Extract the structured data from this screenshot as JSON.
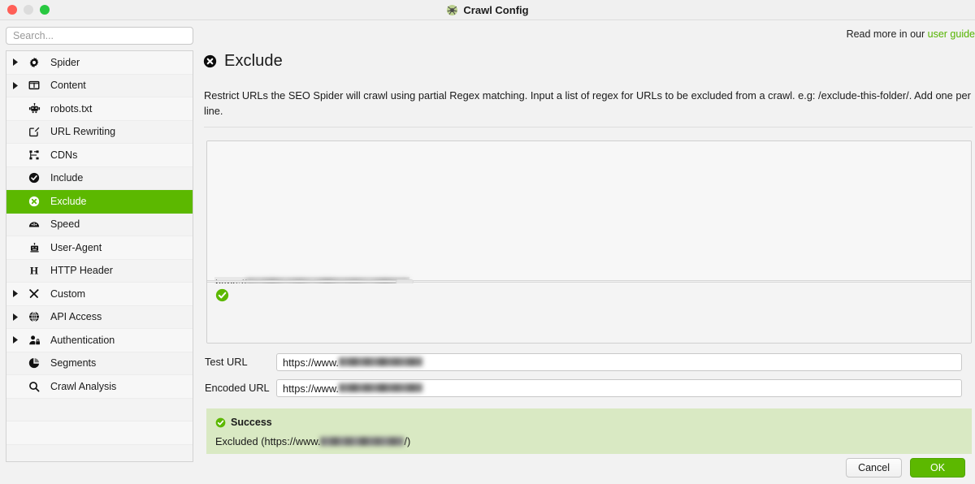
{
  "window": {
    "title": "Crawl Config",
    "title_icon": "spider-icon",
    "controls": {
      "close": "close-button",
      "minimize": "minimize-button",
      "maximize": "maximize-button"
    }
  },
  "colors": {
    "accent_green": "#5cb800",
    "link_green": "#55b400",
    "success_bg": "#d9e9c3",
    "traffic_red": "#ff5f57",
    "traffic_gray": "#dcdcdc",
    "traffic_green": "#28c840"
  },
  "sidebar": {
    "search": {
      "placeholder": "Search...",
      "value": ""
    },
    "items": [
      {
        "label": "Spider",
        "icon": "gear-icon",
        "expandable": true,
        "selected": false
      },
      {
        "label": "Content",
        "icon": "columns-icon",
        "expandable": true,
        "selected": false
      },
      {
        "label": "robots.txt",
        "icon": "robot-icon",
        "expandable": false,
        "selected": false
      },
      {
        "label": "URL Rewriting",
        "icon": "edit-square-icon",
        "expandable": false,
        "selected": false
      },
      {
        "label": "CDNs",
        "icon": "sitemap-icon",
        "expandable": false,
        "selected": false
      },
      {
        "label": "Include",
        "icon": "check-circle-icon",
        "expandable": false,
        "selected": false
      },
      {
        "label": "Exclude",
        "icon": "x-circle-icon",
        "expandable": false,
        "selected": true
      },
      {
        "label": "Speed",
        "icon": "gauge-icon",
        "expandable": false,
        "selected": false
      },
      {
        "label": "User-Agent",
        "icon": "robot-head-icon",
        "expandable": false,
        "selected": false
      },
      {
        "label": "HTTP Header",
        "icon": "letter-h-icon",
        "expandable": false,
        "selected": false
      },
      {
        "label": "Custom",
        "icon": "tools-icon",
        "expandable": true,
        "selected": false
      },
      {
        "label": "API Access",
        "icon": "globe-icon",
        "expandable": true,
        "selected": false
      },
      {
        "label": "Authentication",
        "icon": "user-lock-icon",
        "expandable": true,
        "selected": false
      },
      {
        "label": "Segments",
        "icon": "pie-chart-icon",
        "expandable": false,
        "selected": false
      },
      {
        "label": "Crawl Analysis",
        "icon": "magnifier-icon",
        "expandable": false,
        "selected": false
      }
    ]
  },
  "main": {
    "header": {
      "icon": "x-circle-icon",
      "title": "Exclude",
      "read_more_prefix": "Read more in our ",
      "read_more_link": "user guide"
    },
    "description": "Restrict URLs the SEO Spider will crawl using partial Regex matching. Input a list of regex for URLs to be excluded from a crawl. e.g: /exclude-this-folder/. Add one per line.",
    "regex_editor": {
      "value_visible_prefix": "https://",
      "value_redacted": true,
      "status_icon": "success-check-icon"
    },
    "test_url": {
      "label": "Test URL",
      "value_visible_prefix": "https://www.",
      "value_redacted": true
    },
    "encoded_url": {
      "label": "Encoded URL",
      "value_visible_prefix": "https://www.",
      "value_redacted": true
    },
    "result": {
      "icon": "success-check-icon",
      "heading": "Success",
      "detail_prefix": "Excluded (https://www.",
      "detail_suffix": "/)",
      "detail_redacted": true
    }
  },
  "footer": {
    "cancel_label": "Cancel",
    "ok_label": "OK"
  }
}
